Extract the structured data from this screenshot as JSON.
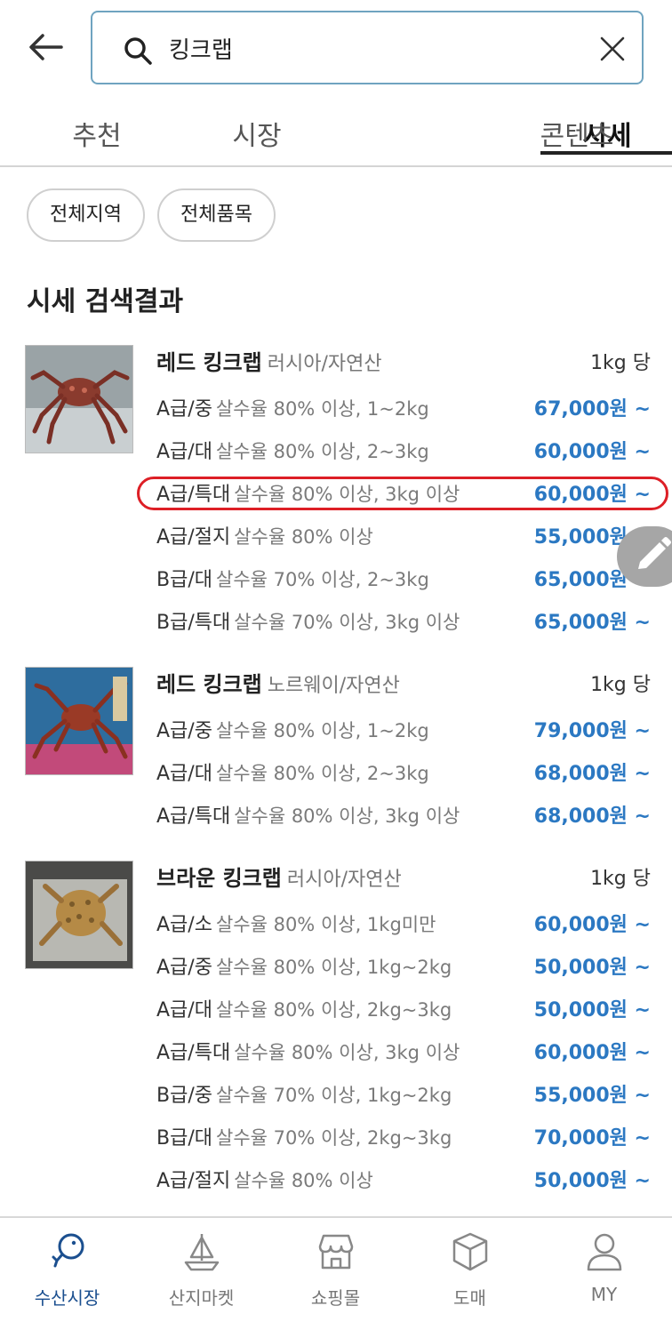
{
  "search": {
    "query": "킹크랩"
  },
  "tabs": [
    {
      "label": "추천"
    },
    {
      "label": "시장"
    },
    {
      "label": "시세"
    },
    {
      "label": "콘텐츠"
    }
  ],
  "active_tab": "시세",
  "filters": [
    {
      "label": "전체지역"
    },
    {
      "label": "전체품목"
    }
  ],
  "section_title": "시세 검색결과",
  "products": [
    {
      "name": "레드 킹크랩",
      "origin": "러시아/자연산",
      "unit": "1kg 당",
      "prices": [
        {
          "grade": "A급/중",
          "desc": "살수율 80% 이상, 1~2kg",
          "price": "67,000원 ~"
        },
        {
          "grade": "A급/대",
          "desc": "살수율 80% 이상, 2~3kg",
          "price": "60,000원 ~"
        },
        {
          "grade": "A급/특대",
          "desc": "살수율 80% 이상, 3kg 이상",
          "price": "60,000원 ~"
        },
        {
          "grade": "A급/절지",
          "desc": "살수율 80% 이상",
          "price": "55,000원 ~"
        },
        {
          "grade": "B급/대",
          "desc": "살수율 70% 이상, 2~3kg",
          "price": "65,000원 ~"
        },
        {
          "grade": "B급/특대",
          "desc": "살수율 70% 이상, 3kg 이상",
          "price": "65,000원 ~"
        }
      ]
    },
    {
      "name": "레드 킹크랩",
      "origin": "노르웨이/자연산",
      "unit": "1kg 당",
      "prices": [
        {
          "grade": "A급/중",
          "desc": "살수율 80% 이상, 1~2kg",
          "price": "79,000원 ~"
        },
        {
          "grade": "A급/대",
          "desc": "살수율 80% 이상, 2~3kg",
          "price": "68,000원 ~"
        },
        {
          "grade": "A급/특대",
          "desc": "살수율 80% 이상, 3kg 이상",
          "price": "68,000원 ~"
        }
      ]
    },
    {
      "name": "브라운 킹크랩",
      "origin": "러시아/자연산",
      "unit": "1kg 당",
      "prices": [
        {
          "grade": "A급/소",
          "desc": "살수율 80% 이상, 1kg미만",
          "price": "60,000원 ~"
        },
        {
          "grade": "A급/중",
          "desc": "살수율 80% 이상, 1kg~2kg",
          "price": "50,000원 ~"
        },
        {
          "grade": "A급/대",
          "desc": "살수율 80% 이상, 2kg~3kg",
          "price": "50,000원 ~"
        },
        {
          "grade": "A급/특대",
          "desc": "살수율 80% 이상, 3kg 이상",
          "price": "60,000원 ~"
        },
        {
          "grade": "B급/중",
          "desc": "살수율 70% 이상, 1kg~2kg",
          "price": "55,000원 ~"
        },
        {
          "grade": "B급/대",
          "desc": "살수율 70% 이상, 2kg~3kg",
          "price": "70,000원 ~"
        },
        {
          "grade": "A급/절지",
          "desc": "살수율 80% 이상",
          "price": "50,000원 ~"
        }
      ]
    }
  ],
  "bottom_nav": [
    {
      "label": "수산시장",
      "icon": "fish-hook-icon"
    },
    {
      "label": "산지마켓",
      "icon": "sailboat-icon"
    },
    {
      "label": "쇼핑몰",
      "icon": "store-icon"
    },
    {
      "label": "도매",
      "icon": "box-icon"
    },
    {
      "label": "MY",
      "icon": "person-icon"
    }
  ],
  "colors": {
    "price": "#2b78c2",
    "accent": "#1b4f8f",
    "highlight": "#dd1f26"
  }
}
